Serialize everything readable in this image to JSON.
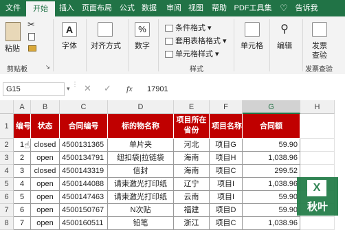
{
  "tabs": [
    "文件",
    "开始",
    "插入",
    "页面布局",
    "公式",
    "数据",
    "审阅",
    "视图",
    "帮助",
    "PDF工具集",
    "告诉我"
  ],
  "ribbon": {
    "clipboard": {
      "paste": "粘贴",
      "group": "剪贴板"
    },
    "font": {
      "label": "字体"
    },
    "alignment": {
      "label": "对齐方式"
    },
    "number": {
      "label": "数字",
      "symbol": "%"
    },
    "styles": {
      "items": [
        "条件格式",
        "套用表格格式",
        "单元格样式"
      ],
      "group": "样式"
    },
    "cells": {
      "label": "单元格"
    },
    "editing": {
      "label": "编辑"
    },
    "invoice": {
      "label1": "发票",
      "label2": "查验",
      "group": "发票查验"
    }
  },
  "formula_bar": {
    "name_box": "G15",
    "fx": "fx",
    "value": "17901"
  },
  "sheet": {
    "columns": [
      "A",
      "B",
      "C",
      "D",
      "E",
      "F",
      "G",
      "H"
    ],
    "selected_column": "G",
    "row_numbers": [
      "1",
      "2",
      "3",
      "4",
      "5",
      "6",
      "7",
      "8"
    ],
    "headers": [
      "编号",
      "状态",
      "合同编号",
      "标的物名称",
      "项目所在省份",
      "项目名称",
      "合同额"
    ],
    "rows": [
      [
        "1",
        "closed",
        "4500131365",
        "单片夹",
        "河北",
        "项目G",
        "59.90"
      ],
      [
        "2",
        "open",
        "4500134791",
        "纽扣袋|拉链袋",
        "海南",
        "项目H",
        "1,038.96"
      ],
      [
        "3",
        "closed",
        "4500143319",
        "信封",
        "海南",
        "项目C",
        "299.52"
      ],
      [
        "4",
        "open",
        "4500144088",
        "请柬激光打印纸",
        "辽宁",
        "项目I",
        "1,038.96"
      ],
      [
        "5",
        "open",
        "4500147463",
        "请柬激光打印纸",
        "云南",
        "项目I",
        "59.90"
      ],
      [
        "6",
        "open",
        "4500150767",
        "N次贴",
        "福建",
        "项目D",
        "59.90"
      ],
      [
        "7",
        "open",
        "4500160511",
        "铅笔",
        "浙江",
        "项目C",
        "1,038.96"
      ]
    ]
  },
  "logo": {
    "text": "秋叶",
    "letter": "X"
  },
  "colors": {
    "brand": "#217346",
    "header_fill": "#c00000"
  }
}
